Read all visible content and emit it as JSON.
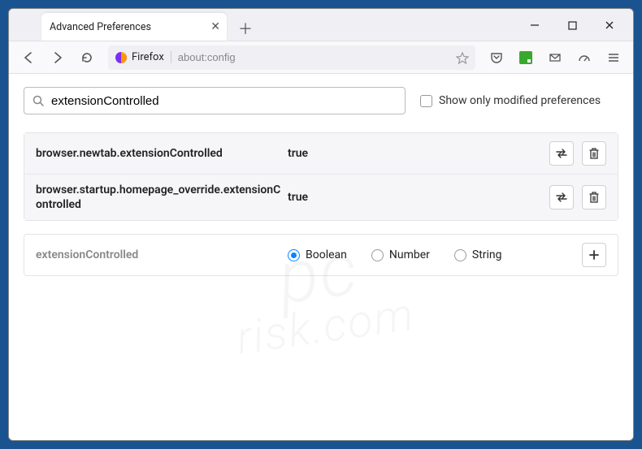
{
  "window": {
    "tab_title": "Advanced Preferences"
  },
  "urlbar": {
    "identity_label": "Firefox",
    "url": "about:config"
  },
  "search": {
    "value": "extensionControlled",
    "modified_only_label": "Show only modified preferences"
  },
  "prefs": [
    {
      "name": "browser.newtab.extensionControlled",
      "value": "true"
    },
    {
      "name": "browser.startup.homepage_override.extensionControlled",
      "value": "true"
    }
  ],
  "new_pref": {
    "name": "extensionControlled",
    "types": {
      "boolean": "Boolean",
      "number": "Number",
      "string": "String"
    }
  },
  "watermark": {
    "line1": "pc",
    "line2": "risk.com"
  }
}
